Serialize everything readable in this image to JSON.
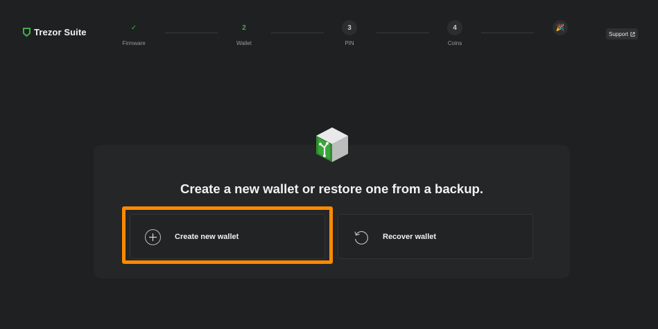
{
  "brand": {
    "name": "Trezor Suite",
    "icon": "trezor-shield-icon",
    "accent": "#3fae4a"
  },
  "stepper": {
    "steps": [
      {
        "id": "firmware",
        "label": "Firmware",
        "marker": "✓",
        "state": "done"
      },
      {
        "id": "wallet",
        "label": "Wallet",
        "marker": "2",
        "state": "active"
      },
      {
        "id": "pin",
        "label": "PIN",
        "marker": "3",
        "state": "pending"
      },
      {
        "id": "coins",
        "label": "Coins",
        "marker": "4",
        "state": "pending"
      },
      {
        "id": "finish",
        "label": "",
        "marker": "🎉",
        "state": "pending"
      }
    ]
  },
  "header": {
    "support_label": "Support",
    "support_icon": "external-link-icon"
  },
  "main": {
    "headline": "Create a new wallet or restore one from a backup.",
    "options": {
      "create": {
        "label": "Create new wallet",
        "icon": "plus-circle-icon"
      },
      "recover": {
        "label": "Recover wallet",
        "icon": "rotate-ccw-icon"
      }
    }
  },
  "colors": {
    "background": "#1f2022",
    "card": "#252628",
    "highlight": "#ff8a00"
  }
}
